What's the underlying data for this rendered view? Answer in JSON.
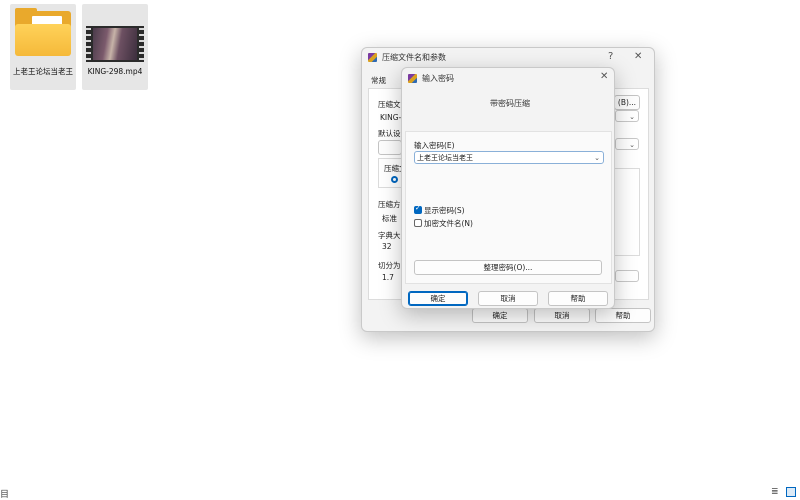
{
  "desktop": {
    "icons": [
      {
        "label": "上老王论坛当老王",
        "icon": "folder-icon"
      },
      {
        "label": "KING-298.mp4",
        "icon": "video-file-icon"
      }
    ]
  },
  "background_dialog": {
    "title": "压缩文件名和参数",
    "help_glyph": "?",
    "close_glyph": "✕",
    "tab_general": "常规",
    "labels": {
      "archive_name": "压缩文",
      "archive_value": "KING-2",
      "browse_button": "(B)...",
      "default_settings": "默认设",
      "format": "压缩文",
      "method": "压缩方",
      "method_value": "标准",
      "dictionary": "字典大",
      "dictionary_value": "32",
      "split": "切分为",
      "split_value": "1.7"
    },
    "buttons": {
      "ok": "确定",
      "cancel": "取消",
      "help": "帮助"
    }
  },
  "password_dialog": {
    "title": "输入密码",
    "close_glyph": "✕",
    "heading": "带密码压缩",
    "password_label": "输入密码(E)",
    "password_value": "上老王论坛当老王",
    "show_password": {
      "label": "显示密码(S)",
      "checked": true
    },
    "encrypt_names": {
      "label": "加密文件名(N)",
      "checked": false
    },
    "manage_button": "整理密码(O)...",
    "buttons": {
      "ok": "确定",
      "cancel": "取消",
      "help": "帮助"
    }
  },
  "taskbar": {
    "left_glyph": "目",
    "right_glyph": "≣"
  },
  "colors": {
    "accent": "#0067c0",
    "folder": "#f5b93a"
  }
}
